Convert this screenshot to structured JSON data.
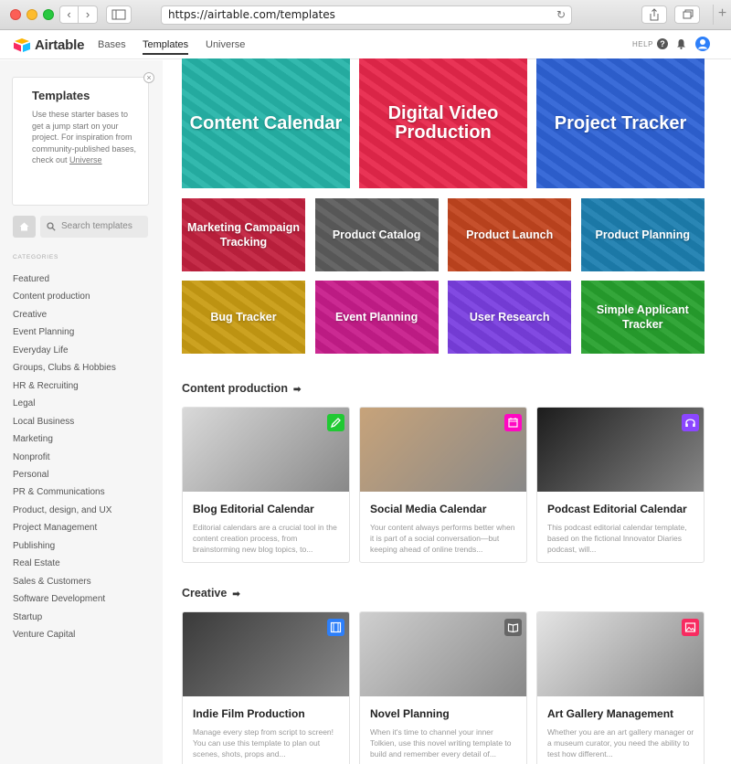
{
  "browser": {
    "url": "https://airtable.com/templates"
  },
  "header": {
    "logo_text": "Airtable",
    "nav": [
      "Bases",
      "Templates",
      "Universe"
    ],
    "help_label": "HELP",
    "help_icon": "?"
  },
  "sidebar": {
    "card_title": "Templates",
    "card_desc": "Use these starter bases to get a jump start on your project. For inspiration from community-published bases, check out",
    "card_link": "Universe",
    "search_placeholder": "Search templates",
    "categories_heading": "CATEGORIES",
    "categories": [
      "Featured",
      "Content production",
      "Creative",
      "Event Planning",
      "Everyday Life",
      "Groups, Clubs & Hobbies",
      "HR & Recruiting",
      "Legal",
      "Local Business",
      "Marketing",
      "Nonprofit",
      "Personal",
      "PR & Communications",
      "Product, design, and UX",
      "Project Management",
      "Publishing",
      "Real Estate",
      "Sales & Customers",
      "Software Development",
      "Startup",
      "Venture Capital"
    ]
  },
  "featured": {
    "big": [
      {
        "label": "Content Calendar",
        "color": "#26b5a9"
      },
      {
        "label": "Digital Video Production",
        "color": "#e8274b"
      },
      {
        "label": "Project Tracker",
        "color": "#2f63d6"
      }
    ],
    "small": [
      {
        "label": "Marketing Campaign Tracking",
        "color": "#c2213f"
      },
      {
        "label": "Product Catalog",
        "color": "#5c5c5c"
      },
      {
        "label": "Product Launch",
        "color": "#c2451f"
      },
      {
        "label": "Product Planning",
        "color": "#1d7fb0"
      },
      {
        "label": "Bug Tracker",
        "color": "#c99c13"
      },
      {
        "label": "Event Planning",
        "color": "#c81d8b"
      },
      {
        "label": "User Research",
        "color": "#7a3fe0"
      },
      {
        "label": "Simple Applicant Tracker",
        "color": "#27a12e"
      }
    ]
  },
  "sections": [
    {
      "title": "Content production",
      "arrow": "➡",
      "cards": [
        {
          "title": "Blog Editorial Calendar",
          "desc": "Editorial calendars are a crucial tool in the content creation process, from brainstorming new blog topics, to...",
          "badge_color": "#20c933",
          "badge_icon": "pencil-icon",
          "photo": "#d9d9d9"
        },
        {
          "title": "Social Media Calendar",
          "desc": "Your content always performs better when it is part of a social conversation—but keeping ahead of online trends...",
          "badge_color": "#ff08c2",
          "badge_icon": "calendar-icon",
          "photo": "#c7a37a"
        },
        {
          "title": "Podcast Editorial Calendar",
          "desc": "This podcast editorial calendar template, based on the fictional Innovator Diaries podcast, will...",
          "badge_color": "#8b46ff",
          "badge_icon": "headphones-icon",
          "photo": "#1c1c1c"
        }
      ]
    },
    {
      "title": "Creative",
      "arrow": "➡",
      "cards": [
        {
          "title": "Indie Film Production",
          "desc": "Manage every step from script to screen! You can use this template to plan out scenes, shots, props and...",
          "badge_color": "#2d7ff9",
          "badge_icon": "film-icon",
          "photo": "#3a3a3a"
        },
        {
          "title": "Novel Planning",
          "desc": "When it's time to channel your inner Tolkien, use this novel writing template to build and remember every detail of...",
          "badge_color": "#666666",
          "badge_icon": "book-icon",
          "photo": "#cfcfcf"
        },
        {
          "title": "Art Gallery Management",
          "desc": "Whether you are an art gallery manager or a museum curator, you need the ability to test how different...",
          "badge_color": "#f82b60",
          "badge_icon": "image-icon",
          "photo": "#e4e4e4"
        }
      ]
    }
  ]
}
